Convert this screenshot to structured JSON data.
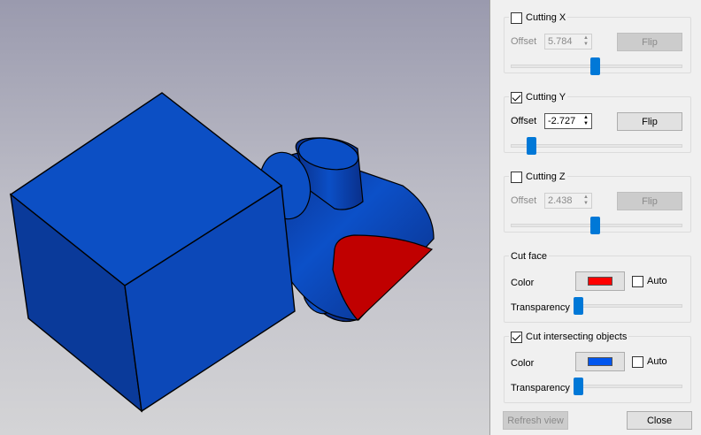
{
  "cutting_x": {
    "title": "Cutting X",
    "checked": false,
    "offset_label": "Offset",
    "offset_value": "5.784",
    "flip_label": "Flip",
    "slider_fraction": 0.49
  },
  "cutting_y": {
    "title": "Cutting Y",
    "checked": true,
    "offset_label": "Offset",
    "offset_value": "-2.727",
    "flip_label": "Flip",
    "slider_fraction": 0.1
  },
  "cutting_z": {
    "title": "Cutting Z",
    "checked": false,
    "offset_label": "Offset",
    "offset_value": "2.438",
    "flip_label": "Flip",
    "slider_fraction": 0.49
  },
  "cut_face": {
    "title": "Cut face",
    "color_label": "Color",
    "color": "#ff0000",
    "auto_label": "Auto",
    "auto_checked": false,
    "transparency_label": "Transparency",
    "transparency_fraction": 0.0
  },
  "cut_intersecting": {
    "title": "Cut intersecting objects",
    "checked": true,
    "color_label": "Color",
    "color": "#0055ee",
    "auto_label": "Auto",
    "auto_checked": false,
    "transparency_label": "Transparency",
    "transparency_fraction": 0.0
  },
  "footer": {
    "refresh_label": "Refresh view",
    "close_label": "Close"
  },
  "scene": {
    "object_color": "#0c4fc4",
    "cut_color": "#c00000"
  }
}
